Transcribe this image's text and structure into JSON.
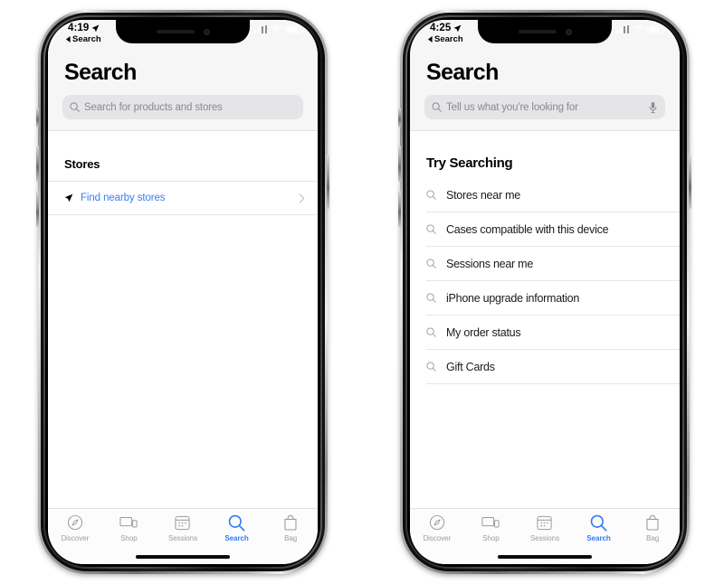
{
  "phones": [
    {
      "id": "phone-left",
      "status": {
        "time": "4:19",
        "back_label": "Search",
        "location_icon": "location-arrow-icon",
        "signal_icon": "cellular-signal-icon",
        "wifi_icon": "wifi-icon",
        "battery_icon": "battery-icon"
      },
      "header": {
        "title": "Search",
        "search": {
          "placeholder": "Search for products and stores",
          "value": "",
          "icon": "search-icon",
          "mic_icon": null
        }
      },
      "body": {
        "kind": "stores",
        "section_title": "Stores",
        "row": {
          "label": "Find nearby stores",
          "leading_icon": "location-arrow-icon",
          "trailing_icon": "chevron-right-icon",
          "color": "#3d7cf0"
        }
      }
    },
    {
      "id": "phone-right",
      "status": {
        "time": "4:25",
        "back_label": "Search",
        "location_icon": "location-arrow-icon",
        "signal_icon": "cellular-signal-icon",
        "wifi_icon": "wifi-icon",
        "battery_icon": "battery-icon"
      },
      "header": {
        "title": "Search",
        "search": {
          "placeholder": "Tell us what you're looking for",
          "value": "",
          "icon": "search-icon",
          "mic_icon": "microphone-icon"
        }
      },
      "body": {
        "kind": "suggestions",
        "section_title": "Try Searching",
        "suggestions": [
          {
            "label": "Stores near me",
            "icon": "search-icon"
          },
          {
            "label": "Cases compatible with this device",
            "icon": "search-icon"
          },
          {
            "label": "Sessions near me",
            "icon": "search-icon"
          },
          {
            "label": "iPhone upgrade information",
            "icon": "search-icon"
          },
          {
            "label": "My order status",
            "icon": "search-icon"
          },
          {
            "label": "Gift Cards",
            "icon": "search-icon"
          }
        ]
      }
    }
  ],
  "tabbar": {
    "active_index": 3,
    "active_color": "#2e7af5",
    "inactive_color": "#9c9c9f",
    "items": [
      {
        "label": "Discover",
        "icon": "compass-icon"
      },
      {
        "label": "Shop",
        "icon": "devices-icon"
      },
      {
        "label": "Sessions",
        "icon": "calendar-icon"
      },
      {
        "label": "Search",
        "icon": "search-icon"
      },
      {
        "label": "Bag",
        "icon": "shopping-bag-icon"
      }
    ]
  }
}
